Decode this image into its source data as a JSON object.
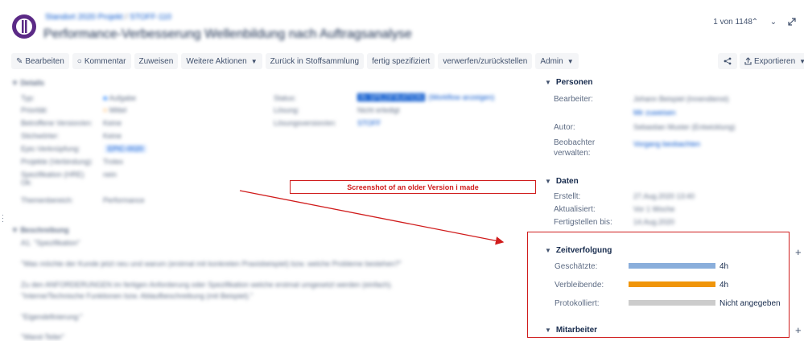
{
  "header": {
    "breadcrumb_project": "Standort 2020 Projekt",
    "breadcrumb_sep": "/",
    "breadcrumb_issue": "STOFF-110",
    "title": "Performance-Verbesserung Wellenbildung nach Auftragsanalyse",
    "pager": "1 von 1148"
  },
  "toolbar": {
    "buttons": [
      "Bearbeiten",
      "Kommentar",
      "Zuweisen",
      "Weitere Aktionen",
      "Zurück in Stoffsammlung",
      "fertig spezifiziert",
      "verwerfen/zurückstellen",
      "Admin"
    ],
    "export_label": "Exportieren"
  },
  "details": {
    "heading": "Details",
    "left_labels": [
      "Typ:",
      "Priorität:",
      "Betroffene Version/en:",
      "Stichwörter:",
      "Epic-Verknüpfung:",
      "Projekte (Verbindung):",
      "Spezifikation (HRE) Ok:",
      "Themenbereich:"
    ],
    "left_values": [
      "Aufgabe",
      "Mittel",
      "Keine",
      "Keine",
      "EPIC-0020",
      "Trotex",
      "nein",
      "Performance"
    ],
    "mid_labels": [
      "Status:",
      "Lösung:",
      "Lösungsversion/en:"
    ],
    "mid_values": [
      "IN SPEZIFIKATION",
      "(Workflow anzeigen)",
      "Nicht erledigt",
      "STOFF"
    ]
  },
  "description": {
    "heading": "Beschreibung",
    "lines": [
      "A1. \"Spezifikation\"",
      "\"Was möchte der Kunde jetzt neu und warum (erstmal mit konkreten Praxisbeispiel) bzw. welche Probleme bestehen?\"",
      "Zu den ANFORDERUNGEN im fertigen Anforderung oder Spezifikation welche erstmal umgesetzt werden (einfach).",
      "\"Interne/Technische Funktionen bzw. Ablaufbeschreibung (mit Beispiel).\"",
      "\"Eigendefinierung:\"",
      "\"Wand-Teiler\""
    ]
  },
  "people": {
    "heading": "Personen",
    "assignee_label": "Bearbeiter:",
    "assignee_value": "Johann Beispiel (Innendienst)",
    "assign_me": "Mir zuweisen",
    "author_label": "Autor:",
    "author_value": "Sebastian Muster (Entwicklung)",
    "watchers_label_1": "Beobachter",
    "watchers_label_2": "verwalten:",
    "watchers_value": "Vorgang beobachten"
  },
  "dates": {
    "heading": "Daten",
    "created_label": "Erstellt:",
    "created_value": "27.Aug.2020 13:40",
    "updated_label": "Aktualisiert:",
    "updated_value": "Vor 1 Woche",
    "due_label": "Fertigstellen bis:",
    "due_value": "14.Aug.2020"
  },
  "annotation": {
    "text": "Screenshot of an older Version i made"
  },
  "time_tracking": {
    "heading": "Zeitverfolgung",
    "rows": [
      {
        "label": "Geschätzte:",
        "value": "4h",
        "fill": 1.0,
        "color": "#8aaedb"
      },
      {
        "label": "Verbleibende:",
        "value": "4h",
        "fill": 1.0,
        "color": "#f0950a"
      },
      {
        "label": "Protokolliert:",
        "value": "Nicht angegeben",
        "fill": 1.0,
        "color": "#cccccc"
      }
    ]
  },
  "collaborators": {
    "heading": "Mitarbeiter"
  },
  "icons": {
    "plus": "+",
    "share": "share-icon",
    "export": "export-icon"
  },
  "colors": {
    "annotation": "#d01c1c",
    "button_bg": "#f4f5f7",
    "link": "#0052cc"
  }
}
